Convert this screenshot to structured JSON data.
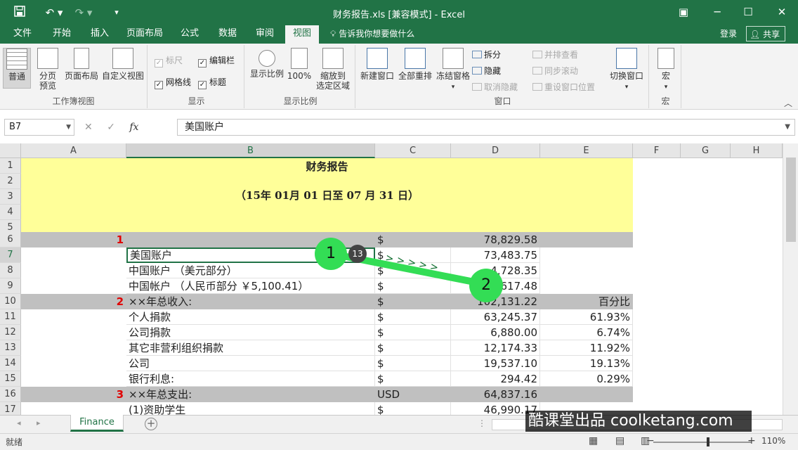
{
  "titlebar": {
    "title": "财务报告.xls  [兼容模式] - Excel",
    "undo_icon": "undo-icon",
    "redo_icon": "redo-icon"
  },
  "tabs": [
    {
      "label": "文件"
    },
    {
      "label": "开始"
    },
    {
      "label": "插入"
    },
    {
      "label": "页面布局"
    },
    {
      "label": "公式"
    },
    {
      "label": "数据"
    },
    {
      "label": "审阅"
    },
    {
      "label": "视图"
    }
  ],
  "tell_me": "告诉我你想要做什么",
  "login": "登录",
  "share": "共享",
  "ribbon": {
    "workbook_views": {
      "label": "工作簿视图",
      "normal": "普通",
      "page_break_1": "分页",
      "page_break_2": "预览",
      "page_layout": "页面布局",
      "custom": "自定义视图"
    },
    "show": {
      "label": "显示",
      "ruler": "标尺",
      "formula_bar": "编辑栏",
      "gridlines": "网格线",
      "headings": "标题"
    },
    "zoom": {
      "label": "显示比例",
      "zoom": "显示比例",
      "hundred": "100%",
      "zoom_sel_1": "缩放到",
      "zoom_sel_2": "选定区域"
    },
    "window": {
      "label": "窗口",
      "new_window": "新建窗口",
      "arrange_all": "全部重排",
      "freeze": "冻结窗格",
      "split": "拆分",
      "hide": "隐藏",
      "unhide": "取消隐藏",
      "side_by_side": "并排查看",
      "sync_scroll": "同步滚动",
      "reset_pos": "重设窗口位置",
      "switch": "切换窗口"
    },
    "macros": {
      "label": "宏",
      "macros": "宏"
    }
  },
  "formula_bar": {
    "name_box": "B7",
    "content": "美国账户"
  },
  "columns": [
    "A",
    "B",
    "C",
    "D",
    "E",
    "F",
    "G",
    "H"
  ],
  "rows": [
    "1",
    "2",
    "3",
    "4",
    "5",
    "6",
    "7",
    "8",
    "9",
    "10",
    "11",
    "12",
    "13",
    "14",
    "15",
    "16",
    "17"
  ],
  "sheet": {
    "title": "财务报告",
    "date_range": "（15年  01月  01  日至  07  月  31  日）",
    "r6": {
      "a": "1",
      "c": "$",
      "d": "78,829.58"
    },
    "r7": {
      "b": "美国账户",
      "c": "$",
      "d": "73,483.75"
    },
    "r8": {
      "b": "中国账户 （美元部分）",
      "c": "$",
      "d": "4,728.35"
    },
    "r9": {
      "b": "中国帐户 （人民币部分 ￥5,100.41）",
      "c": "$",
      "d": "617.48"
    },
    "r10": {
      "a": "2",
      "b": "××年总收入:",
      "c": "$",
      "d": "102,131.22",
      "e": "百分比"
    },
    "r11": {
      "b": "个人捐款",
      "c": "$",
      "d": "63,245.37",
      "e": "61.93%"
    },
    "r12": {
      "b": "公司捐款",
      "c": "$",
      "d": "6,880.00",
      "e": "6.74%"
    },
    "r13": {
      "b": "其它非营利组织捐款",
      "c": "$",
      "d": "12,174.33",
      "e": "11.92%"
    },
    "r14": {
      "b": "公司",
      "c": "$",
      "d": "19,537.10",
      "e": "19.13%"
    },
    "r15": {
      "b": "银行利息:",
      "c": "$",
      "d": "294.42",
      "e": "0.29%"
    },
    "r16": {
      "a": "3",
      "b": "××年总支出:",
      "c": "USD",
      "d": "64,837.16"
    },
    "r17": {
      "b": "(1)资助学生",
      "c": "$",
      "d": "46,990.17"
    }
  },
  "sheet_tab": "Finance",
  "status": {
    "ready": "就绪",
    "zoom": "110%"
  },
  "annotation": {
    "step1": "1",
    "step2": "2",
    "badge": "13",
    "arrow": "> > > > >"
  },
  "watermark": "酷课堂出品 coolketang.com",
  "colors": {
    "excel_green": "#217346",
    "header_yellow": "#ffff99",
    "section_gray": "#c0c0c0",
    "marker_green": "#33dd55"
  }
}
